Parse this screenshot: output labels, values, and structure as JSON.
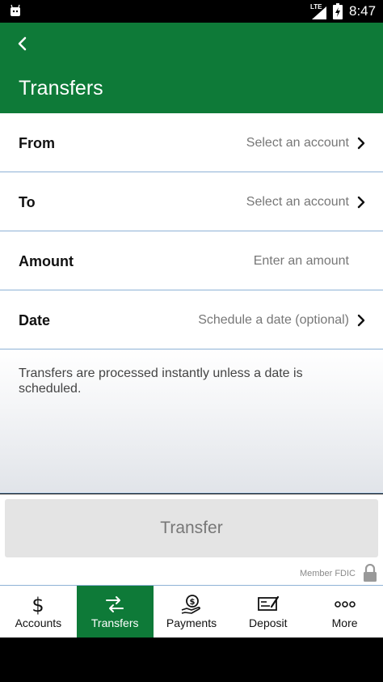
{
  "status_bar": {
    "network": "LTE",
    "time": "8:47",
    "icons": [
      "android-debug-icon",
      "signal-icon",
      "battery-icon"
    ]
  },
  "app_bar": {
    "back_icon": "chevron-left-icon",
    "title": "Transfers"
  },
  "form": {
    "rows": [
      {
        "label": "From",
        "value": "Select an account",
        "icon": "chevron-right-icon"
      },
      {
        "label": "To",
        "value": "Select an account",
        "icon": "chevron-right-icon"
      },
      {
        "label": "Amount",
        "value": "Enter an amount"
      },
      {
        "label": "Date",
        "value": "Schedule a date (optional)",
        "icon": "chevron-right-icon"
      }
    ]
  },
  "info": {
    "note": "Transfers are processed instantly unless a date is scheduled."
  },
  "actions": {
    "transfer_label": "Transfer",
    "fdic_label": "Member FDIC",
    "lock_icon": "lock-icon"
  },
  "tab_bar": {
    "active": "Transfers",
    "tabs": [
      {
        "label": "Accounts",
        "icon": "dollar-icon"
      },
      {
        "label": "Transfers",
        "icon": "transfer-arrows-icon"
      },
      {
        "label": "Payments",
        "icon": "payment-hand-icon"
      },
      {
        "label": "Deposit",
        "icon": "check-deposit-icon"
      },
      {
        "label": "More",
        "icon": "more-dots-icon"
      }
    ]
  },
  "colors": {
    "brand_green": "#0e7a38",
    "divider": "#8eb2d6",
    "button_bg": "#e4e4e4"
  }
}
